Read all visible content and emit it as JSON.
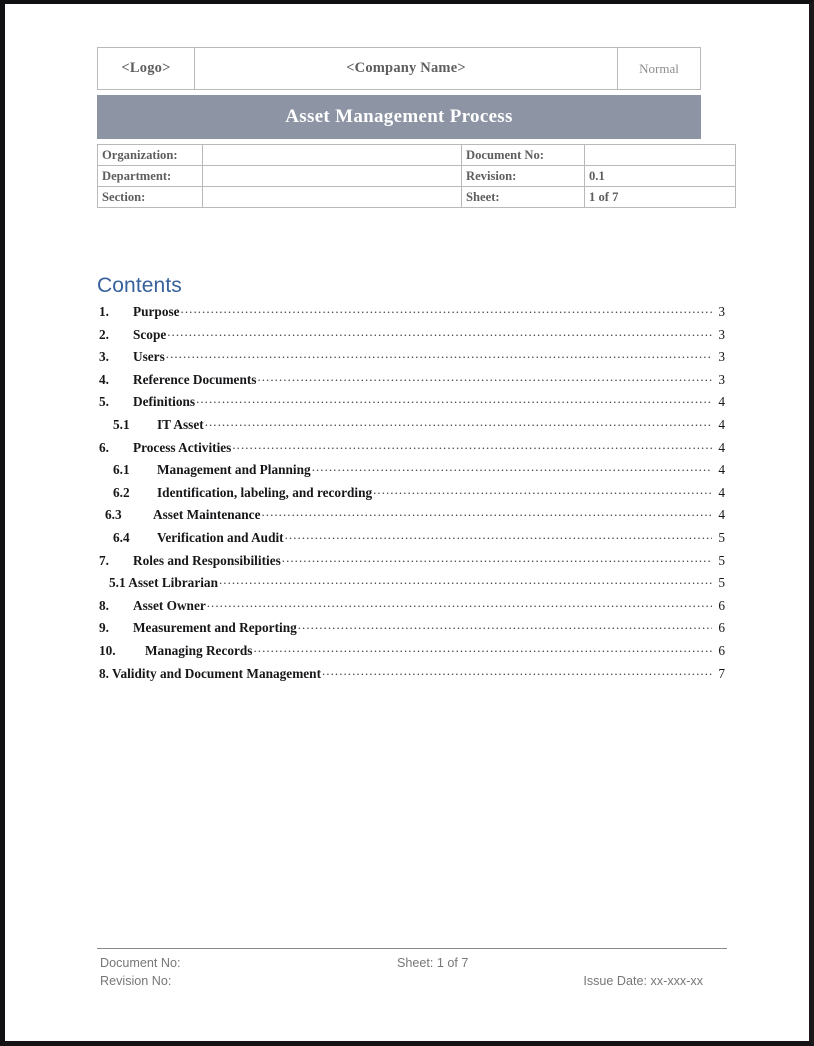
{
  "header": {
    "logo": "<Logo>",
    "company_name": "<Company Name>",
    "status": "Normal"
  },
  "banner": {
    "title": "Asset Management Process",
    "background_color": "#8d94a4",
    "text_color": "#ffffff"
  },
  "info_table": {
    "rows": [
      {
        "label_a": "Organization:",
        "value_a": "",
        "label_b": "Document No:",
        "value_b": ""
      },
      {
        "label_a": "Department:",
        "value_a": "",
        "label_b": "Revision:",
        "value_b": "0.1"
      },
      {
        "label_a": "Section:",
        "value_a": "",
        "label_b": "Sheet:",
        "value_b": "1 of 7"
      }
    ]
  },
  "contents": {
    "heading": "Contents",
    "heading_color": "#36619c",
    "entries": [
      {
        "number": "1.",
        "label": "Purpose",
        "page": "3",
        "level": "lvl1"
      },
      {
        "number": "2.",
        "label": "Scope",
        "page": "3",
        "level": "lvl1"
      },
      {
        "number": "3.",
        "label": "Users",
        "page": "3",
        "level": "lvl1"
      },
      {
        "number": "4.",
        "label": "Reference Documents",
        "page": "3",
        "level": "lvl1"
      },
      {
        "number": "5.",
        "label": "Definitions",
        "page": "4",
        "level": "lvl1"
      },
      {
        "number": "5.1",
        "label": "IT Asset",
        "page": "4",
        "level": "lvl2"
      },
      {
        "number": "6.",
        "label": "Process Activities",
        "page": "4",
        "level": "lvl1"
      },
      {
        "number": "6.1",
        "label": "Management and Planning",
        "page": "4",
        "level": "lvl2"
      },
      {
        "number": "6.2",
        "label": "Identification, labeling, and recording",
        "page": "4",
        "level": "lvl2"
      },
      {
        "number": "6.3",
        "label": "Asset Maintenance",
        "page": "4",
        "level": "lvl2b"
      },
      {
        "number": "6.4",
        "label": "Verification and Audit",
        "page": "5",
        "level": "lvl2"
      },
      {
        "number": "7.",
        "label": "Roles and Responsibilities",
        "page": "5",
        "level": "lvl1"
      },
      {
        "number": "",
        "label": "5.1 Asset Librarian",
        "page": "5",
        "level": "lvl-plain"
      },
      {
        "number": "8.",
        "label": "Asset Owner",
        "page": "6",
        "level": "lvl1"
      },
      {
        "number": "9.",
        "label": "Measurement and Reporting",
        "page": "6",
        "level": "lvl1"
      },
      {
        "number": "10.",
        "label": "Managing Records",
        "page": "6",
        "level": "lvl1-wide"
      },
      {
        "number": "",
        "label": "8. Validity and Document Management",
        "page": "7",
        "level": "lvl-flat"
      }
    ]
  },
  "footer": {
    "document_no": "Document No:",
    "sheet": "Sheet: 1 of 7",
    "revision_no": "Revision No:",
    "issue_date": "Issue Date: xx-xxx-xx"
  }
}
